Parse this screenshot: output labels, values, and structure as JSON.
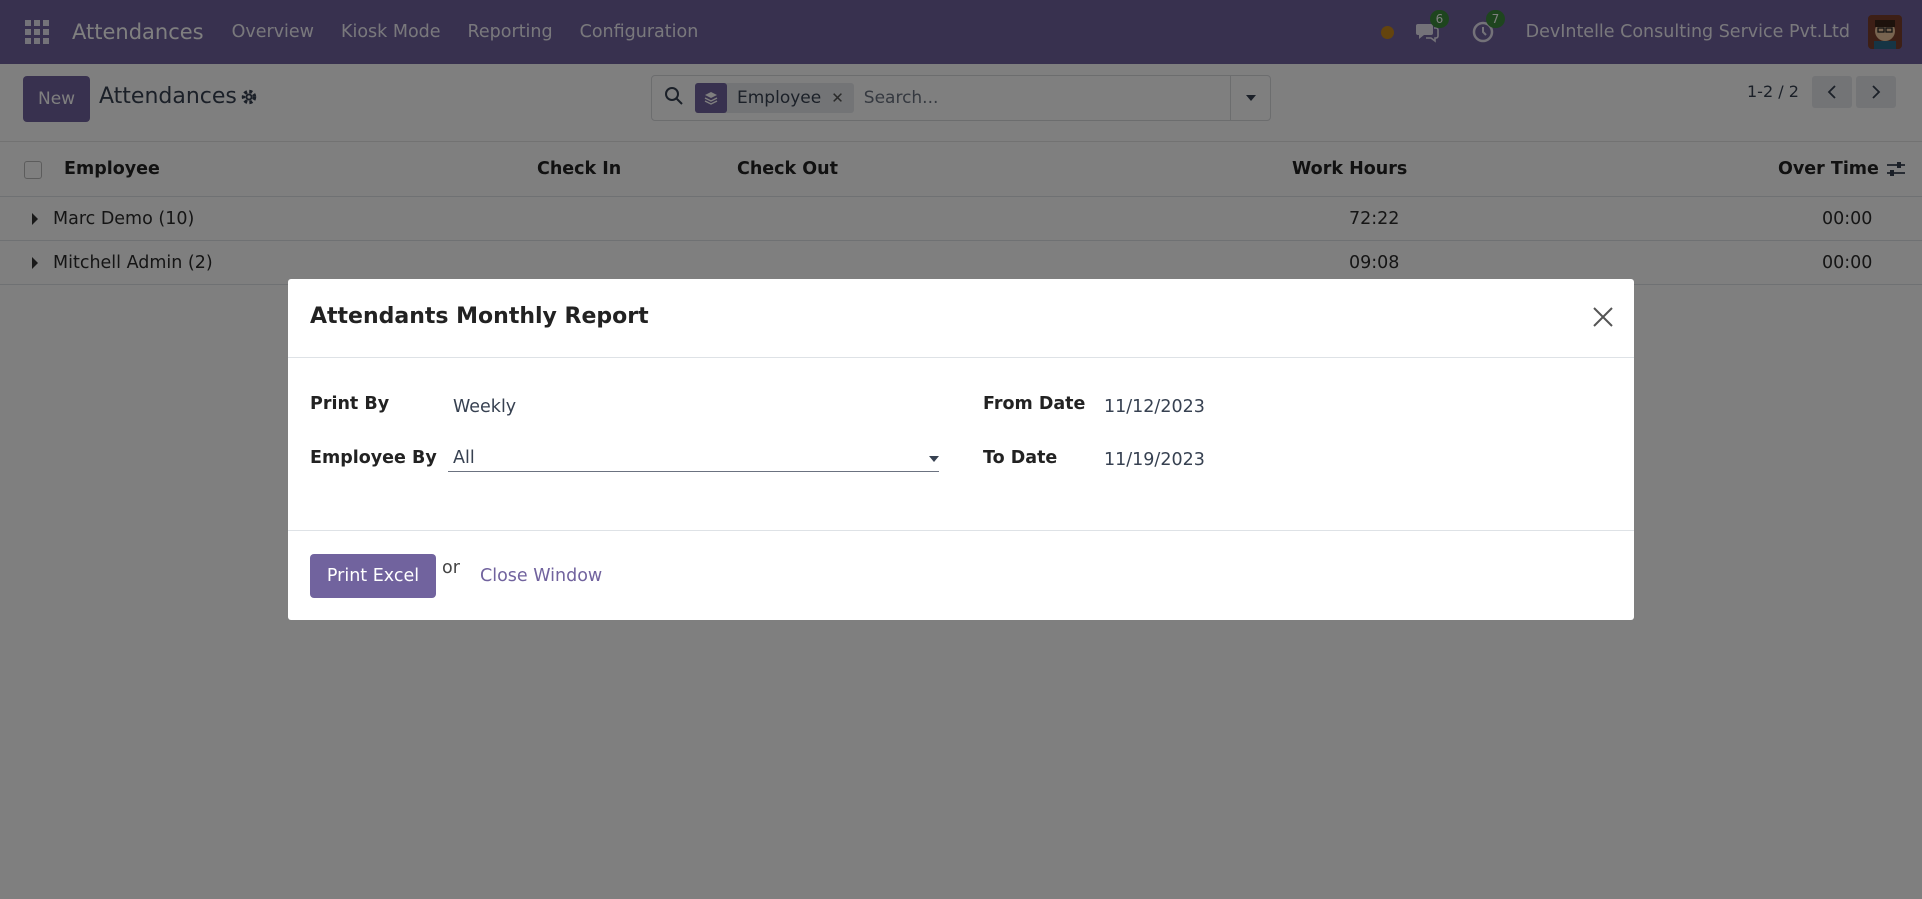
{
  "navbar": {
    "app_name": "Attendances",
    "menu": [
      "Overview",
      "Kiosk Mode",
      "Reporting",
      "Configuration"
    ],
    "messages_count": "6",
    "activities_count": "7",
    "company": "DevIntelle Consulting Service Pvt.Ltd"
  },
  "control": {
    "new_label": "New",
    "breadcrumb": "Attendances",
    "facet_label": "Employee",
    "search_placeholder": "Search...",
    "pager": "1-2 / 2"
  },
  "list": {
    "columns": [
      "Employee",
      "Check In",
      "Check Out",
      "Work Hours",
      "Over Time"
    ],
    "rows": [
      {
        "group": "Marc Demo (10)",
        "work_hours": "72:22",
        "over_time": "00:00"
      },
      {
        "group": "Mitchell Admin (2)",
        "work_hours": "09:08",
        "over_time": "00:00"
      }
    ]
  },
  "modal": {
    "title": "Attendants Monthly Report",
    "print_by_label": "Print By",
    "print_by_value": "Weekly",
    "employee_by_label": "Employee By",
    "employee_by_value": "All",
    "from_date_label": "From Date",
    "from_date_value": "11/12/2023",
    "to_date_label": "To Date",
    "to_date_value": "11/19/2023",
    "print_button": "Print Excel",
    "or_text": "or",
    "close_link": "Close Window"
  },
  "colors": {
    "brand": "#71639e",
    "badge": "#3c8a3c",
    "status_dot": "#c8891c"
  }
}
